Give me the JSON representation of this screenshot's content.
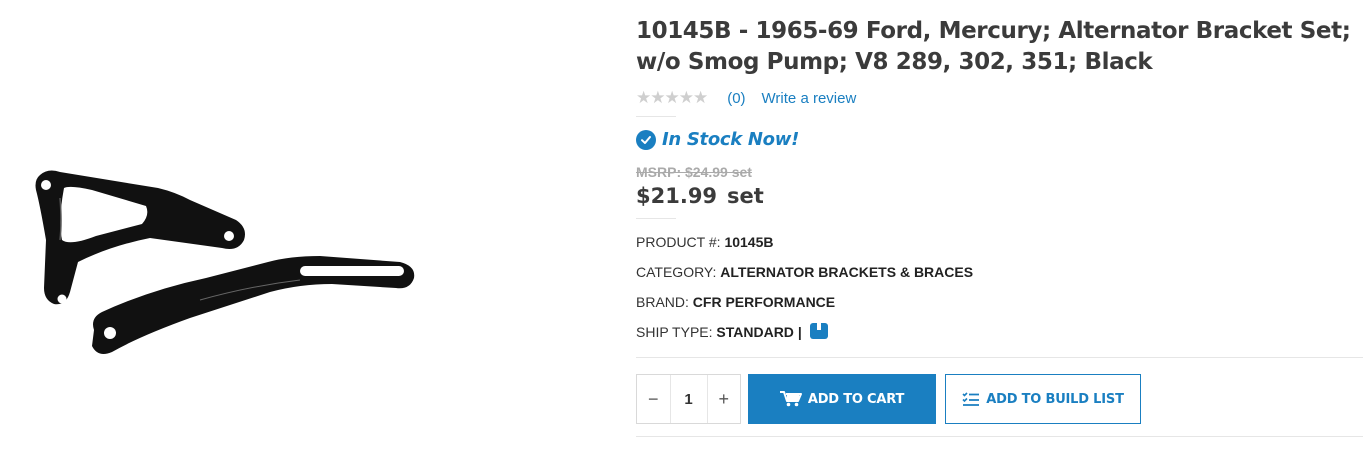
{
  "product": {
    "title": "10145B - 1965-69 Ford, Mercury; Alternator Bracket Set; w/o Smog Pump; V8 289, 302, 351; Black",
    "image_alt": "Alternator bracket set, black"
  },
  "rating": {
    "stars_display": "★★★★★",
    "stars_value": 0,
    "review_count": "(0)",
    "write_review": "Write a review"
  },
  "stock": {
    "text": "In Stock Now!"
  },
  "pricing": {
    "msrp": "MSRP: $24.99 set",
    "price": "$21.99",
    "unit": "set"
  },
  "specs": {
    "product_no_label": "PRODUCT #:",
    "product_no": "10145B",
    "category_label": "CATEGORY:",
    "category": "ALTERNATOR BRACKETS & BRACES",
    "brand_label": "BRAND:",
    "brand": "CFR PERFORMANCE",
    "ship_label": "SHIP TYPE:",
    "ship": "STANDARD",
    "ship_sep": "|"
  },
  "cart": {
    "minus": "−",
    "plus": "+",
    "quantity": "1",
    "add_to_cart": "ADD TO CART",
    "add_to_build_list": "ADD TO BUILD LIST"
  },
  "colors": {
    "accent": "#1a7fc1",
    "title": "#3b3b3b",
    "muted": "#aaaaaa"
  },
  "icons": {
    "stock": "check-circle-icon",
    "cart": "cart-icon",
    "build_list": "checklist-icon",
    "ship": "package-icon"
  }
}
